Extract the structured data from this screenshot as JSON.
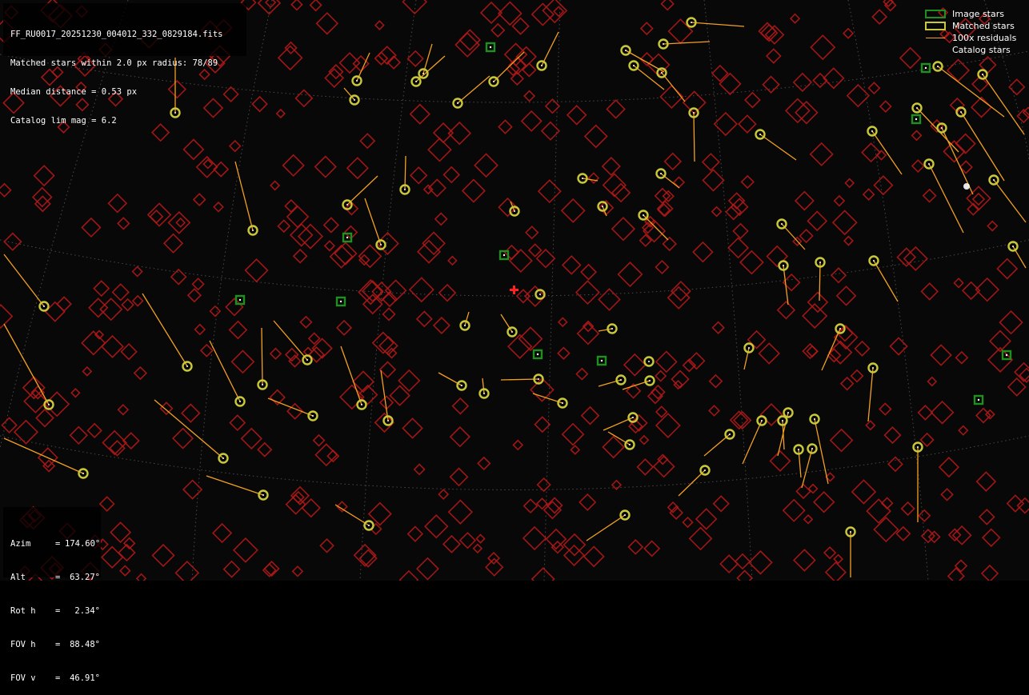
{
  "header": {
    "filename": "FF_RU0017_20251230_004012_332_0829184.fits",
    "matched_line": "Matched stars within 2.0 px radius: 78/89",
    "median_line": "Median distance = 0.53 px",
    "limmag_line": "Catalog lim mag = 6.2"
  },
  "pointing": [
    {
      "key": "Azim",
      "value": "174.60°"
    },
    {
      "key": "Alt",
      "value": "63.27°"
    },
    {
      "key": "Rot h",
      "value": "2.34°"
    },
    {
      "key": "FOV h",
      "value": "88.48°"
    },
    {
      "key": "FOV v",
      "value": "46.91°"
    }
  ],
  "legend": {
    "image_stars": "Image stars",
    "matched_stars": "Matched stars",
    "residuals": "100x residuals",
    "catalog_stars": "Catalog stars"
  },
  "colors": {
    "background": "#080808",
    "catalog": "#b01818",
    "matched": "#c8c83a",
    "image": "#1f8f1f",
    "residual": "#f2a020",
    "grid": "#5a5a5a",
    "center_marker": "#ff2020"
  }
}
